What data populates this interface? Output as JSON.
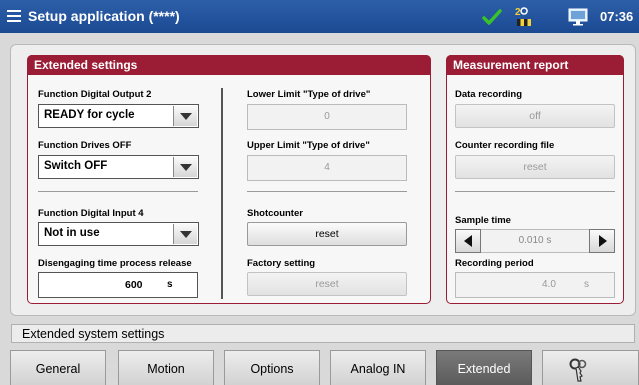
{
  "header": {
    "title": "Setup application (****)",
    "clock": "07:36",
    "icons": [
      "menu-icon",
      "check-icon",
      "user-icon",
      "monitor-icon"
    ],
    "accent_color": "#1b4a93"
  },
  "extended_settings": {
    "title": "Extended settings",
    "function_digital_output_2": {
      "label": "Function Digital Output 2",
      "value": "READY for cycle"
    },
    "function_drives_off": {
      "label": "Function Drives OFF",
      "value": "Switch OFF"
    },
    "function_digital_input_4": {
      "label": "Function Digital Input 4",
      "value": "Not in use"
    },
    "disengaging_time": {
      "label": "Disengaging time process release",
      "value": "600",
      "unit": "s"
    },
    "lower_limit": {
      "label": "Lower Limit \"Type of drive\"",
      "value": "0"
    },
    "upper_limit": {
      "label": "Upper Limit \"Type of drive\"",
      "value": "4"
    },
    "shotcounter": {
      "label": "Shotcounter",
      "button": "reset"
    },
    "factory_setting": {
      "label": "Factory setting",
      "button": "reset"
    },
    "header_color": "#9b1c35"
  },
  "measurement_report": {
    "title": "Measurement report",
    "data_recording": {
      "label": "Data recording",
      "button": "off"
    },
    "counter_recording_file": {
      "label": "Counter recording file",
      "button": "reset"
    },
    "sample_time": {
      "label": "Sample time",
      "value": "0.010 s"
    },
    "recording_period": {
      "label": "Recording period",
      "value": "4.0",
      "unit": "s"
    }
  },
  "status": {
    "text": "Extended system settings"
  },
  "tabs": [
    {
      "label": "General"
    },
    {
      "label": "Motion"
    },
    {
      "label": "Options"
    },
    {
      "label": "Analog IN"
    },
    {
      "label": "Extended",
      "active": true
    },
    {
      "label": "",
      "icon": "key-icon"
    }
  ]
}
